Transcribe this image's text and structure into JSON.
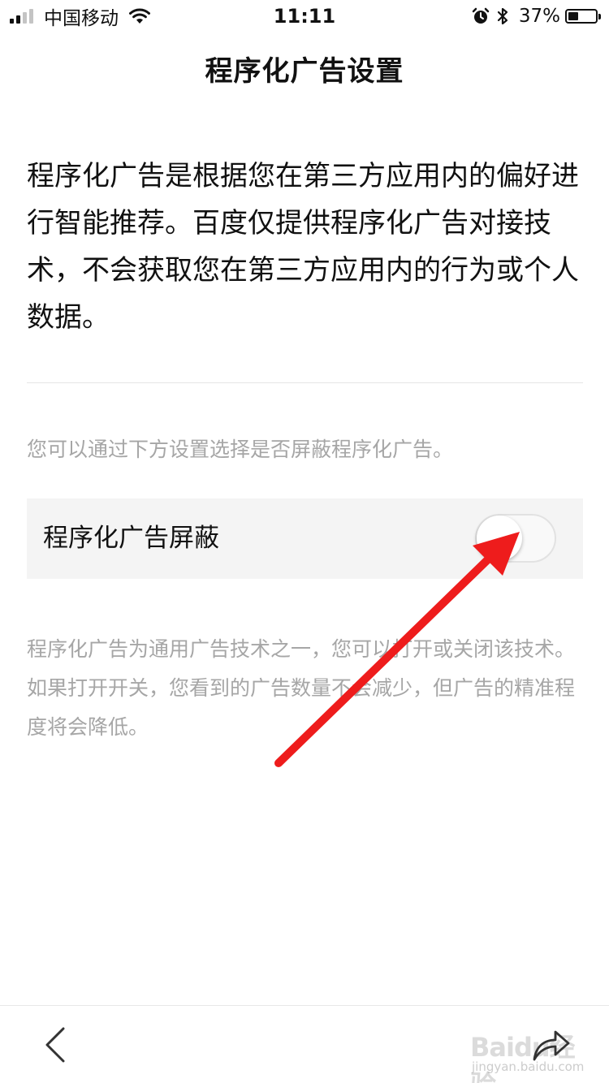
{
  "status_bar": {
    "carrier": "中国移动",
    "time": "11:11",
    "battery_percent": "37%",
    "battery_level": 0.37,
    "signal_bars_filled": 2,
    "signal_bars_total": 4,
    "icons": [
      "signal-icon",
      "wifi-icon",
      "alarm-icon",
      "bluetooth-icon",
      "battery-icon"
    ]
  },
  "nav": {
    "title": "程序化广告设置"
  },
  "intro": {
    "text": "程序化广告是根据您在第三方应用内的偏好进行智能推荐。百度仅提供程序化广告对接技术，不会获取您在第三方应用内的行为或个人数据。"
  },
  "hint": {
    "text": "您可以通过下方设置选择是否屏蔽程序化广告。"
  },
  "setting": {
    "label": "程序化广告屏蔽",
    "toggle_on": false
  },
  "description": {
    "text": "程序化广告为通用广告技术之一，您可以打开或关闭该技术。如果打开开关，您看到的广告数量不会减少，但广告的精准程度将会降低。"
  },
  "bottom_bar": {
    "icons": [
      "back-chevron-icon",
      "share-icon"
    ]
  },
  "watermark": {
    "logo": "Baidu经验",
    "sub": "jingyan.baidu.com"
  },
  "colors": {
    "text_primary": "#111111",
    "text_secondary": "#a6a6a6",
    "row_background": "#f4f4f4",
    "divider": "#e6e6e6",
    "annotation_arrow": "#ee1c1c"
  }
}
